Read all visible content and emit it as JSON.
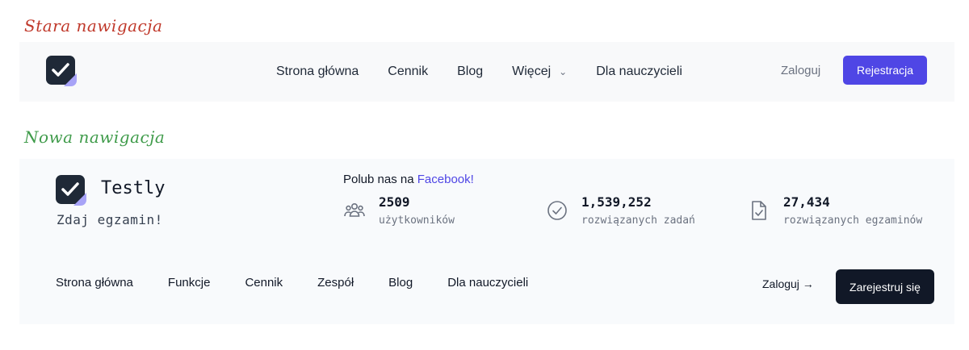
{
  "labels": {
    "old": "Stara nawigacja",
    "new": "Nowa nawigacja"
  },
  "old_nav": {
    "links": [
      "Strona główna",
      "Cennik",
      "Blog",
      "Więcej",
      "Dla nauczycieli"
    ],
    "login": "Zaloguj",
    "register": "Rejestracja",
    "colors": {
      "accent": "#4f46e5"
    }
  },
  "new_nav": {
    "brand": "Testly",
    "tagline": "Zdaj egzamin!",
    "facebook_prefix": "Polub nas na",
    "facebook_link": "Facebook!",
    "stats": [
      {
        "icon": "users-icon",
        "value": "2509",
        "caption": "użytkowników"
      },
      {
        "icon": "check-circle-icon",
        "value": "1,539,252",
        "caption": "rozwiązanych zadań"
      },
      {
        "icon": "document-check-icon",
        "value": "27,434",
        "caption": "rozwiązanych egzaminów"
      }
    ],
    "links": [
      "Strona główna",
      "Funkcje",
      "Cennik",
      "Zespół",
      "Blog",
      "Dla nauczycieli"
    ],
    "login": "Zaloguj →",
    "register": "Zarejestruj się",
    "colors": {
      "button": "#111827"
    }
  }
}
